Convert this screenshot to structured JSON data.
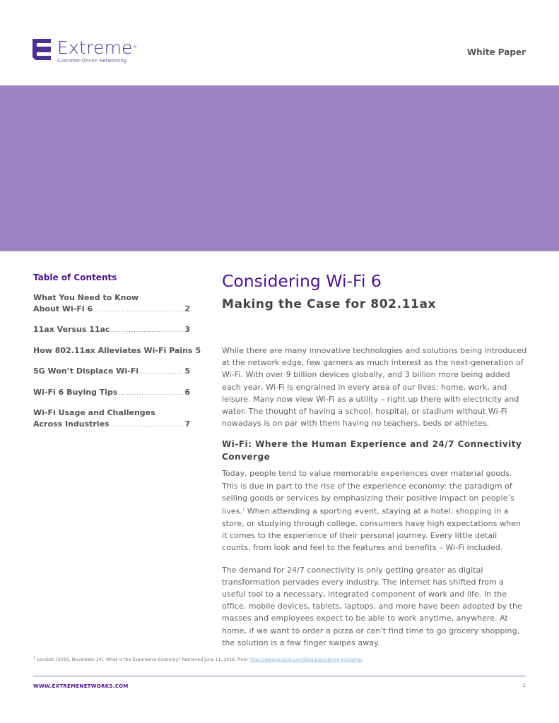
{
  "header": {
    "brand_name": "Extreme",
    "brand_trademark": "™",
    "brand_tagline": "Customer-Driven Networking",
    "doc_type": "White Paper",
    "brand_color": "#4c2f8f"
  },
  "banner": {
    "color": "#9b82c2"
  },
  "toc": {
    "title": "Table of Contents",
    "items": [
      {
        "line1": "What You Need to Know",
        "label": "About Wi-Fi 6",
        "page": "2"
      },
      {
        "line1": "",
        "label": "11ax Versus 11ac",
        "page": "3"
      },
      {
        "line1": "",
        "label": "How 802.11ax Alleviates Wi-Fi Pains",
        "page": "5"
      },
      {
        "line1": "",
        "label": "5G Won’t Displace Wi-Fi",
        "page": "5"
      },
      {
        "line1": "",
        "label": "Wi-Fi 6 Buying Tips",
        "page": "6"
      },
      {
        "line1": "Wi-Fi Usage and Challenges",
        "label": "Across Industries",
        "page": "7"
      }
    ]
  },
  "main": {
    "title": "Considering Wi-Fi 6",
    "subtitle": "Making the Case for 802.11ax",
    "intro": "While there are many innovative technologies and solutions being introduced at the network edge, few garners as much interest as the next-generation of Wi-Fi. With over 9 billion devices globally, and 3 billion more being added each year, Wi-Fi is engrained in every area of our lives: home, work, and leisure. Many now view Wi-Fi as a utility – right up there with electricity and water. The thought of having a school, hospital, or stadium without Wi-Fi nowadays is on par with them having no teachers, beds or athletes.",
    "section_heading": "Wi-Fi: Where the Human Experience and 24/7 Connectivity Converge",
    "para2_part1": "Today, people tend to value memorable experiences over material goods. This is due in part to the rise of the experience economy: the paradigm of selling goods or services by emphasizing their positive impact on people’s lives.",
    "para2_footnote_ref": "1",
    "para2_part2": " When attending a sporting event, staying at a hotel, shopping in a store, or studying through college, consumers have high expectations when it comes to the experience of their personal journey. Every little detail counts, from look and feel to the features and benefits – Wi-Fi included.",
    "para3": "The demand for 24/7 connectivity is only getting greater as digital transformation pervades every industry. The internet has shifted from a useful tool to a necessary, integrated component of work and life. In the office, mobile devices, tablets, laptops, and more have been adopted by the masses and employees expect to be able to work anytime, anywhere. At home, if we want to order a pizza or can’t find time to go grocery shopping, the solution is a few finger swipes away."
  },
  "footnote": {
    "marker": "1",
    "text": " Localist. (2016, November 14). What is the Experience Economy? Retrieved June 11, 2019, from ",
    "link": "https://www.localist.com/blog/experience-economy/"
  },
  "footer": {
    "url": "WWW.EXTREMENETWORKS.COM",
    "page_number": "1"
  }
}
